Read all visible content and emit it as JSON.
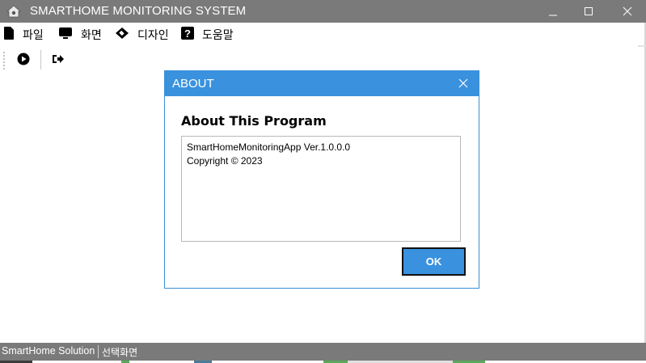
{
  "window": {
    "title": "SMARTHOME MONITORING SYSTEM",
    "minimize_icon": "minimize-icon",
    "maximize_icon": "maximize-icon",
    "close_icon": "close-icon"
  },
  "menu": {
    "items": [
      {
        "label": "파일",
        "icon": "file-icon"
      },
      {
        "label": "화면",
        "icon": "monitor-icon"
      },
      {
        "label": "디자인",
        "icon": "palette-icon"
      },
      {
        "label": "도움말",
        "icon": "help-icon"
      }
    ]
  },
  "toolbar": {
    "buttons": [
      {
        "icon": "play-circle-icon"
      },
      {
        "icon": "sign-out-icon"
      }
    ]
  },
  "dialog": {
    "title": "ABOUT",
    "heading": "About This Program",
    "text_lines": [
      "SmartHomeMonitoringApp Ver.1.0.0.0",
      "Copyright ©  2023"
    ],
    "ok_label": "OK"
  },
  "status": {
    "left": "SmartHome Solution",
    "right": "선택화면"
  },
  "colors": {
    "titlebar": "#7a7a7a",
    "accent": "#3a92de",
    "statusbar": "#7a7a7a"
  }
}
